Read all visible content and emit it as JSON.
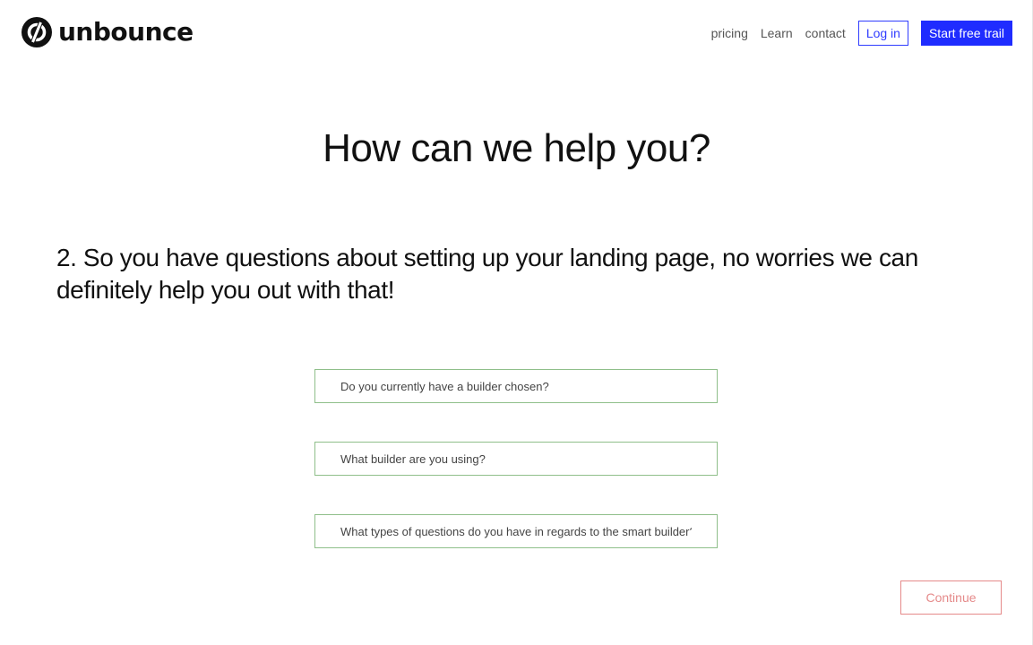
{
  "brand": {
    "name": "unbounce",
    "logo_icon": "unbounce-logo-icon"
  },
  "nav": {
    "links": [
      "pricing",
      "Learn",
      "contact"
    ],
    "login_label": "Log in",
    "start_label": "Start free trail"
  },
  "main": {
    "heading": "How can we help you?",
    "subheading": "2. So you have questions about setting up your landing page, no worries we can definitely help you out with that!",
    "fields": [
      {
        "value": "",
        "placeholder": "Do you currently have a builder chosen?"
      },
      {
        "value": "",
        "placeholder": "What builder are you using?"
      },
      {
        "value": "",
        "placeholder": "What types of questions do you have in regards to the smart builder?"
      }
    ],
    "continue_label": "Continue"
  },
  "colors": {
    "accent": "#1f2cff",
    "field_border": "#8fbf8a",
    "continue": "#e58a8a"
  }
}
